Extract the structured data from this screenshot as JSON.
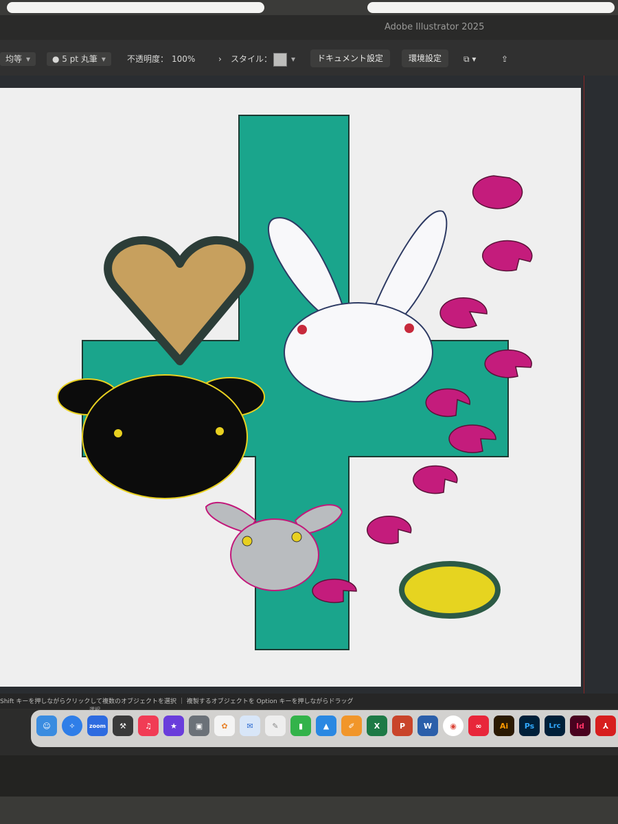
{
  "app": {
    "title": "Adobe Illustrator 2025"
  },
  "controlbar": {
    "stroke_type": "均等",
    "brush": "5 pt 丸筆",
    "opacity_label": "不透明度：",
    "opacity_value": "100%",
    "style_label": "スタイル：",
    "doc_settings": "ドキュメント設定",
    "preferences": "環境設定"
  },
  "status": {
    "hint": "Shift キーを押しながらクリックして複数のオブジェクトを選択 ｜ 複製するオブジェクトを Option キーを押しながらドラッグ",
    "tool": "選択"
  },
  "artwork": {
    "objects": [
      "cross",
      "heart",
      "bear",
      "rabbit",
      "small-creature",
      "pie-shapes",
      "oval"
    ],
    "colors": {
      "cross": "#1aa58c",
      "heart": "#c7a05e",
      "heart_stroke": "#2c3d38",
      "bear": "#0c0c0c",
      "bear_stroke": "#e8d020",
      "rabbit": "#f8f8fa",
      "rabbit_stroke": "#2d3a63",
      "creature": "#b9bcbf",
      "creature_stroke": "#c2187a",
      "pie": "#c41c7c",
      "oval": "#e6d420",
      "oval_stroke": "#2c5a45"
    }
  },
  "dock": {
    "apps": [
      "Finder",
      "Safari",
      "Zoom",
      "Instruments",
      "Music",
      "iMovie",
      "Preview",
      "Photos",
      "Mail",
      "Pencil",
      "Numbers",
      "Keynote",
      "Pages",
      "Excel",
      "PowerPoint",
      "Word",
      "Chrome",
      "Creative Cloud",
      "Ai",
      "Ps",
      "Lrc",
      "Id",
      "Acrobat"
    ]
  }
}
